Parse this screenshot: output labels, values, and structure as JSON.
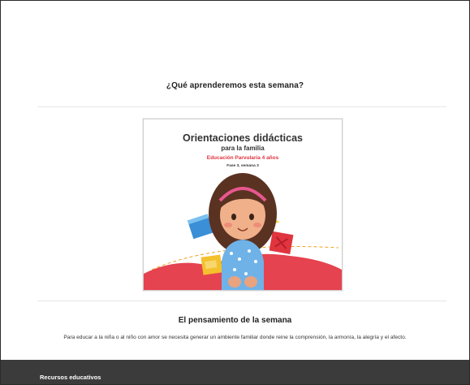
{
  "section": {
    "heading": "¿Qué aprenderemos esta semana?"
  },
  "cover": {
    "title": "Orientaciones didácticas",
    "subtitle": "para la familia",
    "level": "Educación Parvularia 4 años",
    "phase": "Fase 3, semana 3",
    "accent_color": "#e0343f"
  },
  "thought": {
    "heading": "El pensamiento de la semana",
    "text": "Para educar a la niña o al niño con amor se necesita generar un ambiente familiar donde reine la comprensión, la armonía, la alegría y el afecto."
  },
  "footer": {
    "title": "Recursos educativos",
    "background": "#3b3b3b"
  }
}
